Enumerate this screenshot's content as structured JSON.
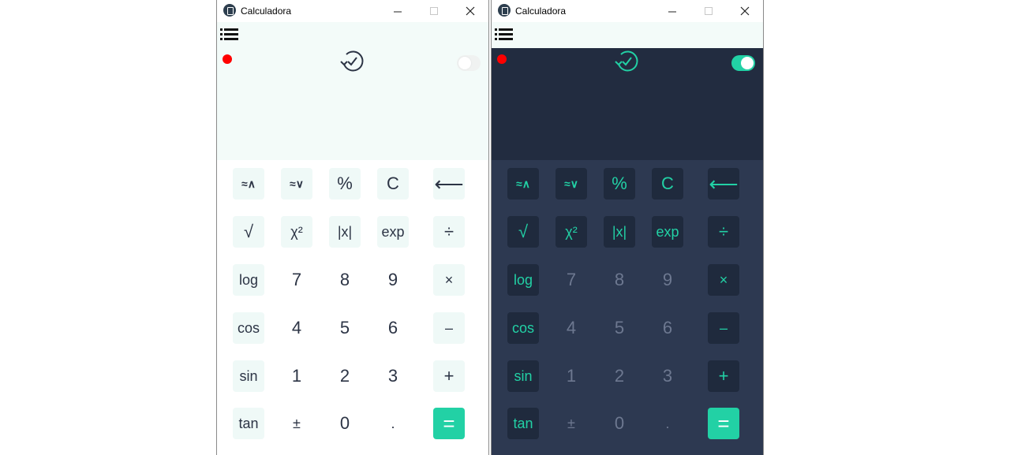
{
  "windows": [
    {
      "theme": "light",
      "title": "Calculadora",
      "dark_mode_on": false,
      "buttons": {
        "approx_up": "≈∧",
        "approx_down": "≈∨",
        "percent": "%",
        "clear": "C",
        "backspace": "⟵",
        "sqrt": "√",
        "square": "χ²",
        "abs": "|x|",
        "exp": "exp",
        "divide": "÷",
        "log": "log",
        "seven": "7",
        "eight": "8",
        "nine": "9",
        "multiply": "×",
        "cos": "cos",
        "four": "4",
        "five": "5",
        "six": "6",
        "minus": "–",
        "sin": "sin",
        "one": "1",
        "two": "2",
        "three": "3",
        "plus": "+",
        "tan": "tan",
        "plusminus": "±",
        "zero": "0",
        "dot": ".",
        "equals": "="
      }
    },
    {
      "theme": "dark",
      "title": "Calculadora",
      "dark_mode_on": true,
      "buttons": {
        "approx_up": "≈∧",
        "approx_down": "≈∨",
        "percent": "%",
        "clear": "C",
        "backspace": "⟵",
        "sqrt": "√",
        "square": "χ²",
        "abs": "|x|",
        "exp": "exp",
        "divide": "÷",
        "log": "log",
        "seven": "7",
        "eight": "8",
        "nine": "9",
        "multiply": "×",
        "cos": "cos",
        "four": "4",
        "five": "5",
        "six": "6",
        "minus": "–",
        "sin": "sin",
        "one": "1",
        "two": "2",
        "three": "3",
        "plus": "+",
        "tan": "tan",
        "plusminus": "±",
        "zero": "0",
        "dot": ".",
        "equals": "="
      }
    }
  ],
  "colors": {
    "accent": "#22d1a5",
    "light_display": "#f3fbf9",
    "dark_display": "#222c40",
    "dark_keypad": "#2d3951",
    "record_dot": "#ff0000"
  }
}
